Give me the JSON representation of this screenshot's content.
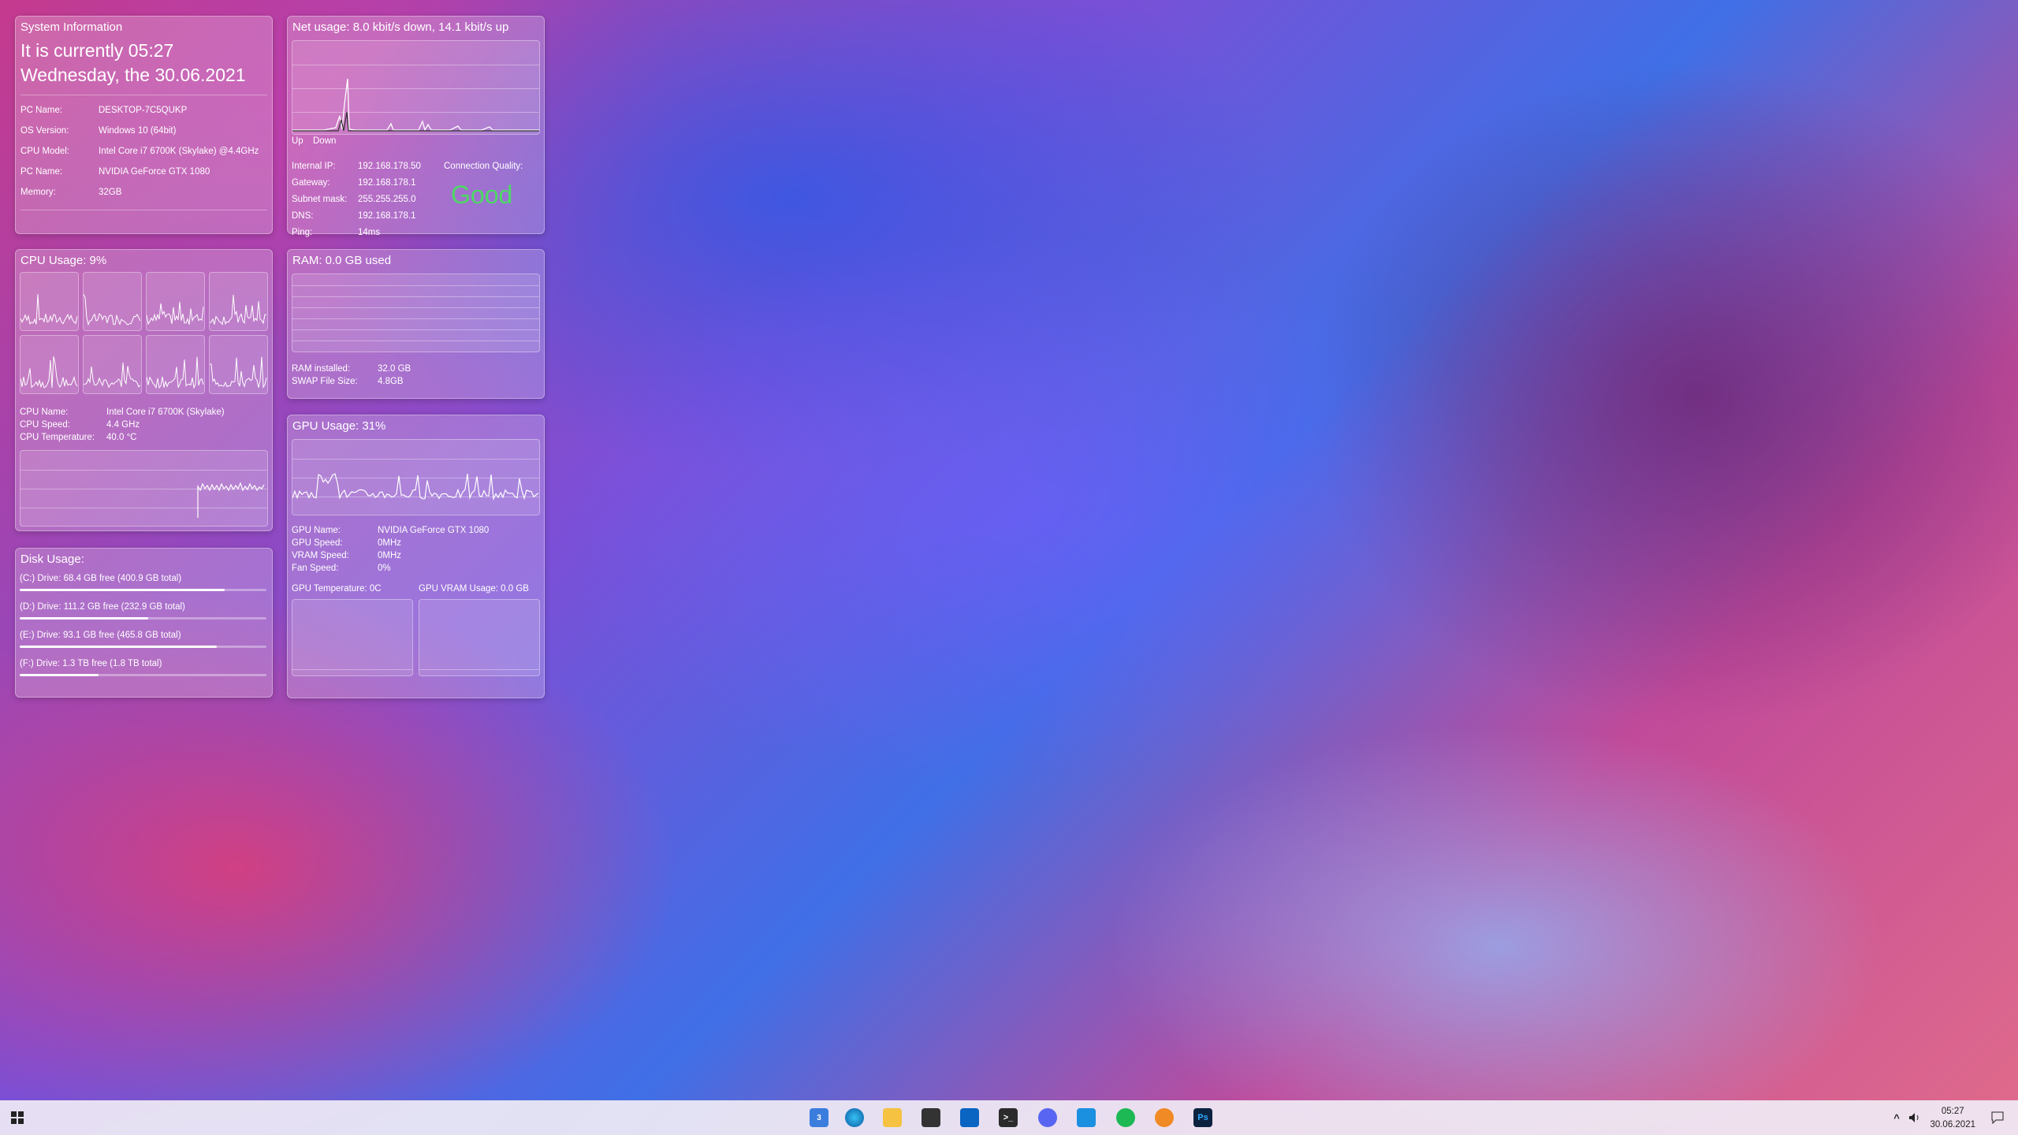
{
  "sysinfo": {
    "title": "System Information",
    "time_line": "It is currently 05:27",
    "date_line": "Wednesday, the 30.06.2021",
    "rows": [
      {
        "label": "PC Name:",
        "value": "DESKTOP-7C5QUKP"
      },
      {
        "label": "OS Version:",
        "value": "Windows 10 (64bit)"
      },
      {
        "label": "CPU Model:",
        "value": "Intel Core i7 6700K (Skylake)  @4.4GHz"
      },
      {
        "label": "PC Name:",
        "value": "NVIDIA GeForce GTX 1080"
      },
      {
        "label": "Memory:",
        "value": "32GB"
      }
    ]
  },
  "net": {
    "title": "Net usage: 8.0 kbit/s down, 14.1 kbit/s up",
    "legend_up": "Up",
    "legend_down": "Down",
    "rows": [
      {
        "label": "Internal IP:",
        "value": "192.168.178.50"
      },
      {
        "label": "Gateway:",
        "value": "192.168.178.1"
      },
      {
        "label": "Subnet mask:",
        "value": "255.255.255.0"
      },
      {
        "label": "DNS:",
        "value": "192.168.178.1"
      },
      {
        "label": "Ping:",
        "value": "14ms"
      }
    ],
    "quality_label": "Connection Quality:",
    "quality_value": "Good",
    "quality_color": "#4cd964"
  },
  "cpu": {
    "title": "CPU Usage: 9%",
    "rows": [
      {
        "label": "CPU Name:",
        "value": "Intel Core i7 6700K (Skylake)"
      },
      {
        "label": "CPU Speed:",
        "value": "4.4 GHz"
      },
      {
        "label": "CPU Temperature:",
        "value": "40.0 °C"
      }
    ]
  },
  "ram": {
    "title": "RAM: 0.0 GB used",
    "rows": [
      {
        "label": "RAM installed:",
        "value": "32.0 GB"
      },
      {
        "label": "SWAP File Size:",
        "value": "4.8GB"
      }
    ]
  },
  "gpu": {
    "title": "GPU Usage: 31%",
    "rows": [
      {
        "label": "GPU Name:",
        "value": "NVIDIA GeForce GTX 1080"
      },
      {
        "label": "GPU Speed:",
        "value": "0MHz"
      },
      {
        "label": "VRAM Speed:",
        "value": "0MHz"
      },
      {
        "label": "Fan Speed:",
        "value": "0%"
      }
    ],
    "temp_label": "GPU Temperature: 0C",
    "vram_label": "GPU VRAM Usage: 0.0 GB"
  },
  "disk": {
    "title": "Disk Usage:",
    "drives": [
      {
        "label": "(C:) Drive: 68.4 GB free (400.9 GB total)",
        "used_fraction": 0.83
      },
      {
        "label": "(D:) Drive: 111.2 GB free (232.9 GB total)",
        "used_fraction": 0.52
      },
      {
        "label": "(E:) Drive: 93.1 GB free (465.8 GB total)",
        "used_fraction": 0.8
      },
      {
        "label": "(F:) Drive: 1.3 TB free (1.8 TB total)",
        "used_fraction": 0.32
      }
    ]
  },
  "taskbar": {
    "start_icon": "windows-start-icon",
    "icons": [
      "file-explorer-badge-icon",
      "edge-icon",
      "folder-icon",
      "store-icon",
      "outlook-icon",
      "terminal-icon",
      "discord-icon",
      "vscode-icon",
      "spotify-icon",
      "blender-icon",
      "photoshop-icon"
    ],
    "explorer_badge": "3",
    "clock_time": "05:27",
    "clock_date": "30.06.2021"
  }
}
